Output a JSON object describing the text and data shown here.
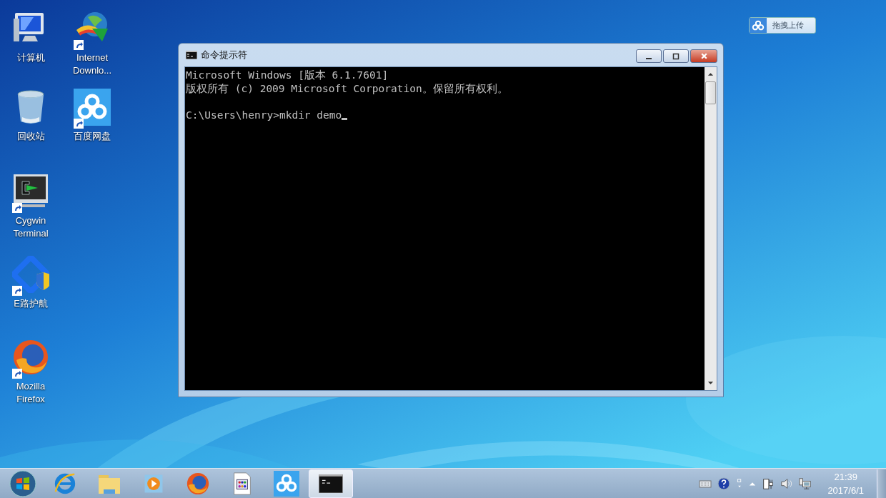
{
  "desktop_icons": [
    {
      "kind": "computer",
      "label": "计算机",
      "shortcut": false
    },
    {
      "kind": "download",
      "label": "Internet Downlo...",
      "shortcut": true
    },
    {
      "kind": "recycle",
      "label": "回收站",
      "shortcut": false
    },
    {
      "kind": "cloud",
      "label": "百度网盘",
      "shortcut": true
    },
    {
      "kind": "terminal",
      "label": "Cygwin Terminal",
      "shortcut": true
    },
    {
      "kind": "shield",
      "label": "E路护航",
      "shortcut": true
    },
    {
      "kind": "firefox",
      "label": "Mozilla Firefox",
      "shortcut": true
    }
  ],
  "upload_widget": {
    "label": "拖拽上传"
  },
  "window": {
    "title": "命令提示符",
    "paragraphs": [
      [
        "Microsoft Windows [版本 6.1.7601]",
        "版权所有 (c) 2009 Microsoft Corporation。保留所有权利。"
      ],
      [
        "C:\\Users\\henry>mkdir demo"
      ]
    ],
    "cursor": true
  },
  "taskbar": {
    "items": [
      {
        "kind": "start",
        "selected": false
      },
      {
        "kind": "ie",
        "selected": false
      },
      {
        "kind": "folder",
        "selected": false
      },
      {
        "kind": "player",
        "selected": false
      },
      {
        "kind": "firefox",
        "selected": false
      },
      {
        "kind": "document",
        "selected": false
      },
      {
        "kind": "cloud",
        "selected": false
      },
      {
        "kind": "terminal",
        "selected": true
      }
    ],
    "clock": {
      "time": "21:39",
      "date": "2017/6/1"
    }
  }
}
